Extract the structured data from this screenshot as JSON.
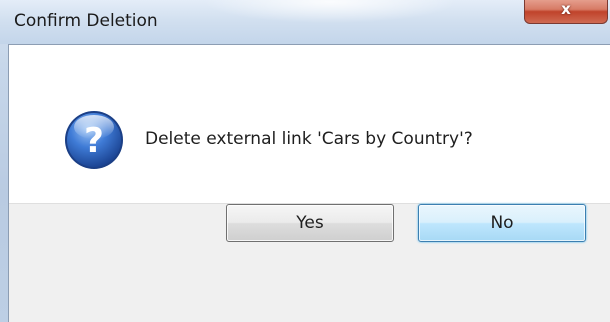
{
  "dialog": {
    "title": "Confirm Deletion",
    "close_glyph": "x",
    "message": "Delete external link 'Cars by Country'?",
    "icon": "question-icon",
    "buttons": {
      "yes_label": "Yes",
      "no_label": "No",
      "default": "no"
    }
  },
  "colors": {
    "close_button": "#c7472e",
    "icon_blue": "#2a5fb8",
    "default_button_border": "#3c7fb1"
  }
}
